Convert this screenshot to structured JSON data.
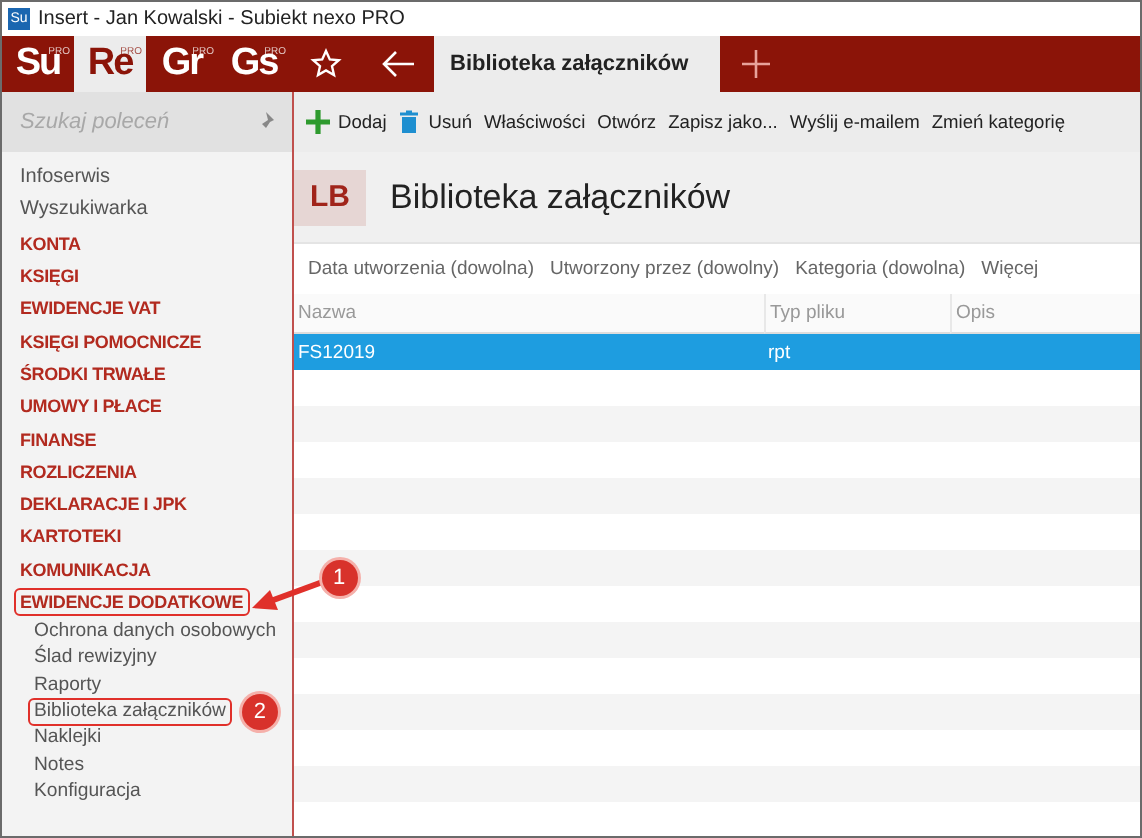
{
  "window": {
    "title": "Insert - Jan Kowalski - Subiekt nexo PRO",
    "app_icon": "Su"
  },
  "modules": [
    {
      "label": "Su",
      "badge": "PRO",
      "selected": false
    },
    {
      "label": "Re",
      "badge": "PRO",
      "selected": true
    },
    {
      "label": "Gr",
      "badge": "PRO",
      "selected": false
    },
    {
      "label": "Gs",
      "badge": "PRO",
      "selected": false
    }
  ],
  "document_tabs": [
    {
      "label": "Biblioteka załączników",
      "selected": true
    }
  ],
  "sidebar": {
    "search_placeholder": "Szukaj poleceń",
    "items": [
      {
        "label": "Infoserwis",
        "kind": "link"
      },
      {
        "label": "Wyszukiwarka",
        "kind": "link"
      },
      {
        "label": "KONTA",
        "kind": "section"
      },
      {
        "label": "KSIĘGI",
        "kind": "section"
      },
      {
        "label": "EWIDENCJE VAT",
        "kind": "section"
      },
      {
        "label": "KSIĘGI POMOCNICZE",
        "kind": "section"
      },
      {
        "label": "ŚRODKI TRWAŁE",
        "kind": "section"
      },
      {
        "label": "UMOWY I PŁACE",
        "kind": "section"
      },
      {
        "label": "FINANSE",
        "kind": "section"
      },
      {
        "label": "ROZLICZENIA",
        "kind": "section"
      },
      {
        "label": "DEKLARACJE I JPK",
        "kind": "section"
      },
      {
        "label": "KARTOTEKI",
        "kind": "section"
      },
      {
        "label": "KOMUNIKACJA",
        "kind": "section"
      },
      {
        "label": "EWIDENCJE DODATKOWE",
        "kind": "section",
        "highlighted": true,
        "callout": "1",
        "children": [
          {
            "label": "Ochrona danych osobowych"
          },
          {
            "label": "Ślad rewizyjny"
          },
          {
            "label": "Raporty"
          },
          {
            "label": "Biblioteka załączników",
            "highlighted": true,
            "callout": "2"
          },
          {
            "label": "Naklejki"
          },
          {
            "label": "Notes"
          },
          {
            "label": "Konfiguracja"
          }
        ]
      }
    ]
  },
  "toolbar": [
    {
      "label": "Dodaj",
      "kind": "add"
    },
    {
      "label": "Usuń",
      "kind": "delete"
    },
    {
      "label": "Właściwości",
      "kind": "text"
    },
    {
      "label": "Otwórz",
      "kind": "text"
    },
    {
      "label": "Zapisz jako...",
      "kind": "text"
    },
    {
      "label": "Wyślij e-mailem",
      "kind": "text"
    },
    {
      "label": "Zmień kategorię",
      "kind": "text"
    }
  ],
  "header": {
    "badge": "LB",
    "title": "Biblioteka załączników"
  },
  "filters": [
    "Data utworzenia (dowolna)",
    "Utworzony przez (dowolny)",
    "Kategoria (dowolna)",
    "Więcej"
  ],
  "table": {
    "columns": [
      "Nazwa",
      "Typ pliku",
      "Opis"
    ],
    "rows": [
      {
        "cells": [
          "FS12019",
          "rpt",
          ""
        ],
        "selected": true
      }
    ]
  }
}
